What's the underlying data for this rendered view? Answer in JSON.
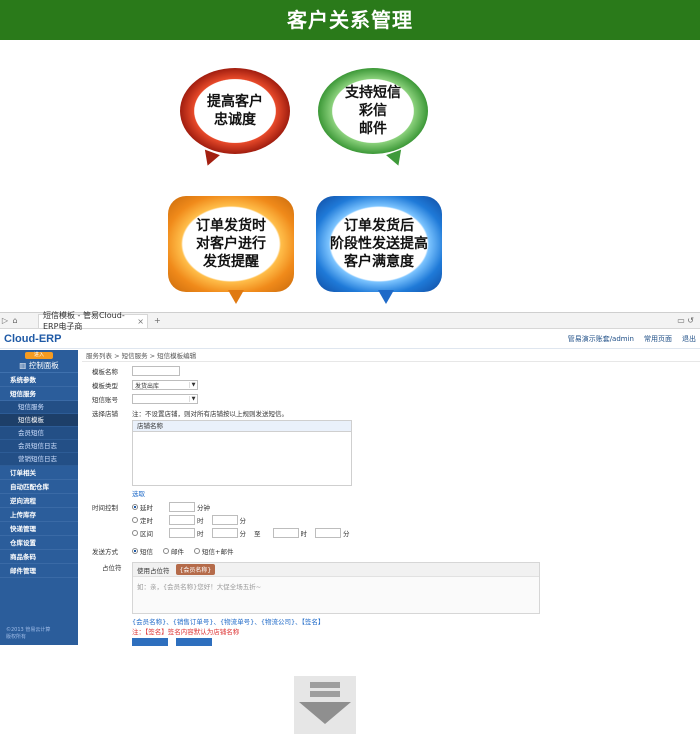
{
  "banner": {
    "title": "客户关系管理"
  },
  "bubbles": [
    {
      "lines": [
        "提高客户",
        "忠诚度"
      ]
    },
    {
      "lines": [
        "支持短信",
        "彩信",
        "邮件"
      ]
    },
    {
      "lines": [
        "订单发货时",
        "对客户进行",
        "发货提醒"
      ]
    },
    {
      "lines": [
        "订单发货后",
        "阶段性发送提高",
        "客户满意度"
      ]
    }
  ],
  "browser": {
    "tab_title": "短信模板 - 管易Cloud-ERP电子商",
    "tab_close": "×",
    "new_tab": "+"
  },
  "app": {
    "logo": "Cloud-ERP",
    "top_right": {
      "user": "管易演示账套/admin",
      "home": "常用页面",
      "exit": "退出"
    },
    "side_tag": "进入",
    "side_head": "控制面板",
    "sidebar": {
      "groups_top": [
        "系统参数",
        "短信服务"
      ],
      "subs": [
        "短信服务",
        "短信模板",
        "会员短信",
        "会员短信日志",
        "营销短信日志"
      ],
      "groups_bottom": [
        "订单相关",
        "自动匹配仓库",
        "逆向流程",
        "上传库存",
        "快递管理",
        "仓库设置",
        "商品条码",
        "邮件管理"
      ],
      "foot": [
        "©2013 管易云计算",
        "版权所有"
      ]
    },
    "breadcrumb": "服务列表 > 短信服务 > 短信模板编辑",
    "form": {
      "template_name_label": "模板名称",
      "template_type_label": "模板类型",
      "template_type_value": "发货出库",
      "sms_account_label": "短信账号",
      "store_label": "选择店铺",
      "store_note": "注：不设置店铺，则对所有店铺按以上规则发送短信。",
      "store_table_header": "店铺名称",
      "select_link": "选取",
      "time_label": "时间控制",
      "time_opts": [
        "延时",
        "定时",
        "区间"
      ],
      "unit_minute": "分钟",
      "hour": "时",
      "minute": "分",
      "to": "至",
      "send_label": "发送方式",
      "send_opts": [
        "短信",
        "邮件",
        "短信+邮件"
      ],
      "placeholder_label": "占位符",
      "use_placeholder": "使用占位符",
      "tag_btn": "{会员名称}",
      "textarea_text": "如：亲，{会员名称}您好！大促全场五折~",
      "tags_line": "{会员名称}、{销售订单号}、{物流单号}、{物流公司}、【签名】",
      "sign_note": "注：【签名】签名内容默认为店铺名称"
    }
  },
  "colors": {
    "banner": "#2a7a1a",
    "sidebar": "#2b5d9b",
    "accent": "#1f6ac8"
  }
}
